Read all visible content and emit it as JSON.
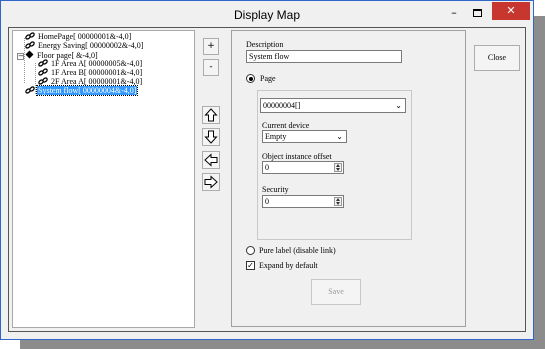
{
  "window": {
    "title": "Display Map"
  },
  "tree": {
    "items": [
      {
        "label": "HomePage[ 00000001&-4,0]",
        "icon": "link-icon",
        "selected": false
      },
      {
        "label": "Energy Saving[ 00000002&-4,0]",
        "icon": "link-icon",
        "selected": false
      },
      {
        "label": "Floor page[ &-4,0]",
        "icon": "folder-icon",
        "selected": false
      },
      {
        "label": "1F Area A[ 00000005&-4,0]",
        "icon": "link-icon",
        "selected": false
      },
      {
        "label": "1F Area B[ 00000001&-4,0]",
        "icon": "link-icon",
        "selected": false
      },
      {
        "label": "2F Area A[ 00000001&-4,0]",
        "icon": "link-icon",
        "selected": false
      },
      {
        "label": "System flow[ 00000004&-4,0]",
        "icon": "link-icon",
        "selected": true
      }
    ]
  },
  "toolbar": {
    "add_label": "+",
    "remove_label": "-",
    "move_up_icon": "arrow-up-icon",
    "move_down_icon": "arrow-down-icon",
    "move_left_icon": "arrow-left-icon",
    "move_right_icon": "arrow-right-icon"
  },
  "form": {
    "description_label": "Description",
    "description_value": "System flow",
    "page_radio_label": "Page",
    "page_selected": true,
    "page_value": "00000004[]",
    "current_device_label": "Current device",
    "current_device_value": "Empty",
    "instance_offset_label": "Object instance offset",
    "instance_offset_value": "0",
    "security_label": "Security",
    "security_value": "0",
    "pure_label_text": "Pure label (disable link)",
    "pure_label_selected": false,
    "expand_default_text": "Expand by default",
    "expand_default_checked": true,
    "save_label": "Save"
  },
  "buttons": {
    "close_label": "Close"
  }
}
